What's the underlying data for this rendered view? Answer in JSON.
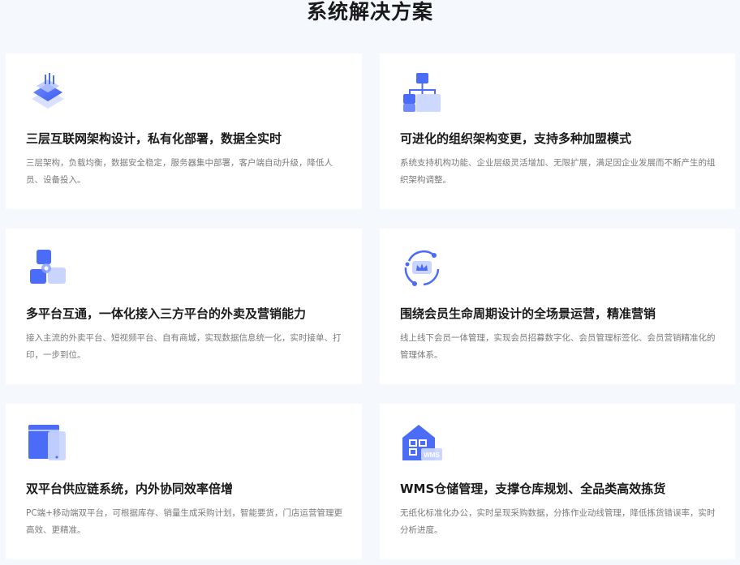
{
  "page": {
    "title": "系统解决方案"
  },
  "cards": [
    {
      "title": "三层互联网架构设计，私有化部署，数据全实时",
      "desc": "三层架构，负载均衡，数据安全稳定，服务器集中部署，客户端自动升级，降低人员、设备投入。",
      "icon": "layers-icon"
    },
    {
      "title": "可进化的组织架构变更，支持多种加盟模式",
      "desc": "系统支持机构功能、企业层级灵活增加、无限扩展，满足因企业发展而不断产生的组织架构调整。",
      "icon": "org-chart-icon"
    },
    {
      "title": "多平台互通，一体化接入三方平台的外卖及营销能力",
      "desc": "接入主流的外卖平台、短视频平台、自有商城，实现数据信息统一化，实时接单、打印，一步到位。",
      "icon": "platform-link-icon"
    },
    {
      "title": "围绕会员生命周期设计的全场景运营，精准营销",
      "desc": "线上线下会员一体管理，实现会员招募数字化、会员管理标签化、会员营销精准化的管理体系。",
      "icon": "member-cycle-icon"
    },
    {
      "title": "双平台供应链系统，内外协同效率倍增",
      "desc": "PC端+移动端双平台，可根据库存、销量生成采购计划，智能要货，门店运营管理更高效、更精准。",
      "icon": "dual-platform-icon"
    },
    {
      "title": "WMS仓储管理，支撑仓库规划、全品类高效拣货",
      "desc": "无纸化标准化办公，实时呈现采购数据，分拣作业动线管理，降低拣货错误率，实时分析进度。",
      "icon": "warehouse-icon",
      "icon_badge": "WMS"
    }
  ],
  "colors": {
    "accent": "#4a6cf7",
    "accent_light": "#c9d5ff"
  }
}
